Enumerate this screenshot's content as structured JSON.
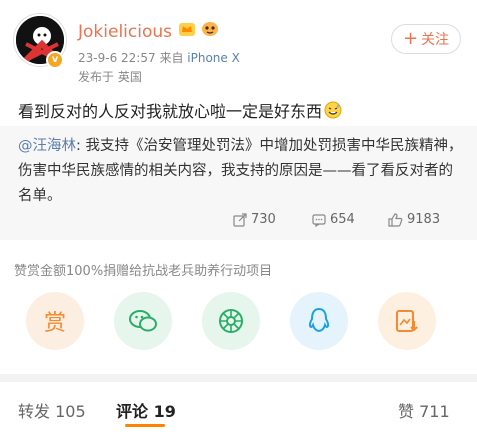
{
  "post": {
    "username": "Jokielicious",
    "timestamp": "23-9-6 22:57",
    "source_prefix": "来自",
    "device": "iPhone X",
    "location": "发布于 英国",
    "follow_label": "关注",
    "follow_plus": "+",
    "text": "看到反对的人反对我就放心啦一定是好东西",
    "avatar_badge": "v"
  },
  "repost": {
    "mention": "@汪海林",
    "body": ": 我支持《治安管理处罚法》中增加处罚损害中华民族精神，伤害中华民族感情的相关内容，我支持的原因是——看了看反对者的名单。"
  },
  "stats": {
    "reposts": "730",
    "comments": "654",
    "likes": "9183"
  },
  "sponsor": {
    "text": "赞赏金额100%捐赠给抗战老兵助养行动项目",
    "reward_label": "赏"
  },
  "share_icons": [
    "reward-icon",
    "wechat-icon",
    "moments-icon",
    "qq-icon",
    "save-image-icon"
  ],
  "tabs": {
    "repost": "转发 105",
    "comment": "评论 19",
    "like": "赞 711"
  },
  "colors": {
    "accent": "#eb7350",
    "link": "#5b7fb0",
    "tab_underline": "#ff8200",
    "wechat": "#2aae67",
    "qq": "#1ea0e8",
    "reward": "#f28b33"
  }
}
